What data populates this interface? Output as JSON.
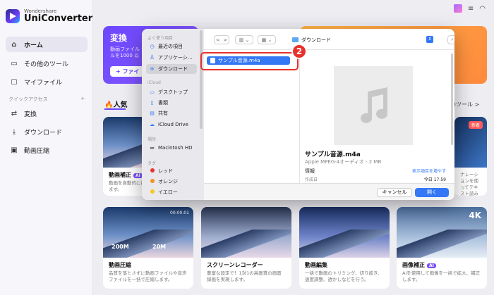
{
  "app": {
    "brand": "Wondershare",
    "name": "UniConverter"
  },
  "sidebar": {
    "items": [
      {
        "label": "ホーム",
        "icon": "home-icon"
      },
      {
        "label": "その他のツール",
        "icon": "toolbox-icon"
      },
      {
        "label": "マイファイル",
        "icon": "file-icon"
      }
    ],
    "quick_access_title": "クイックアクセス",
    "quick_items": [
      {
        "label": "変換",
        "icon": "convert-icon"
      },
      {
        "label": "ダウンロード",
        "icon": "download-icon"
      },
      {
        "label": "動画圧縮",
        "icon": "compress-icon"
      }
    ]
  },
  "main": {
    "banner_title": "変換",
    "banner_desc": "動画ファイル\nルを1000 以",
    "banner_button": "+ ファイ",
    "popular_tab": "🔥人気",
    "other_tools_link": "他のツール >",
    "cards_row1": [
      {
        "title": "動画補正",
        "ai": "AI",
        "desc": "動画を自動的に補正して、品質を改善します。"
      },
      {
        "title": "",
        "new_badge": "新着",
        "desc": "ナレーションを使ってテキスト読み上げ"
      }
    ],
    "cards_row2": [
      {
        "title": "動画圧縮",
        "desc": "品質を落とさずに動画ファイルや音声ファイルを一括で圧縮します。",
        "overlay_from": "200M",
        "overlay_to": "20M",
        "timer": "00:00:01"
      },
      {
        "title": "スクリーンレコーダー",
        "desc": "豊富な設定で！1対1の高画質の画面録画を実現します。"
      },
      {
        "title": "動画編集",
        "desc": "一括で動画のトリミング、切り抜き、速度調整、透かしなどを行う。"
      },
      {
        "title": "画像補正",
        "ai": "AI",
        "desc": "AIを使用して画像を一括で拡大、補正します。",
        "badge_4k": "4K"
      }
    ]
  },
  "dialog": {
    "sidebar": {
      "favorites_title": "よく使う項目",
      "favorites": [
        {
          "label": "最近の項目",
          "icon": "clock-icon"
        },
        {
          "label": "アプリケーシ…",
          "icon": "apps-icon"
        },
        {
          "label": "ダウンロード",
          "icon": "download-icon"
        }
      ],
      "icloud_title": "iCloud",
      "icloud": [
        {
          "label": "デスクトップ",
          "icon": "desktop-icon"
        },
        {
          "label": "書類",
          "icon": "document-icon"
        },
        {
          "label": "共有",
          "icon": "shared-folder-icon"
        },
        {
          "label": "iCloud Drive",
          "icon": "cloud-icon"
        }
      ],
      "places_title": "場所",
      "places": [
        {
          "label": "Macintosh HD",
          "icon": "disk-icon"
        }
      ],
      "tags_title": "タグ",
      "tags": [
        {
          "label": "レッド",
          "color": "#e8322e"
        },
        {
          "label": "オレンジ",
          "color": "#f0931d"
        },
        {
          "label": "イエロー",
          "color": "#f4c81d"
        }
      ]
    },
    "toolbar": {
      "back": "<",
      "forward": ">",
      "location": "ダウンロード",
      "search_placeholder": "検索"
    },
    "selected_file": "サンプル音源.m4a",
    "step_number": "2",
    "preview": {
      "name": "サンプル音源.m4a",
      "kind": "Apple MPEG-4オーディオ - 2 MB",
      "info_label": "情報",
      "show_more": "表示項目を増やす",
      "created_label": "作成日",
      "created_value": "今日 17:59"
    },
    "cancel_label": "キャンセル",
    "open_label": "開く"
  }
}
